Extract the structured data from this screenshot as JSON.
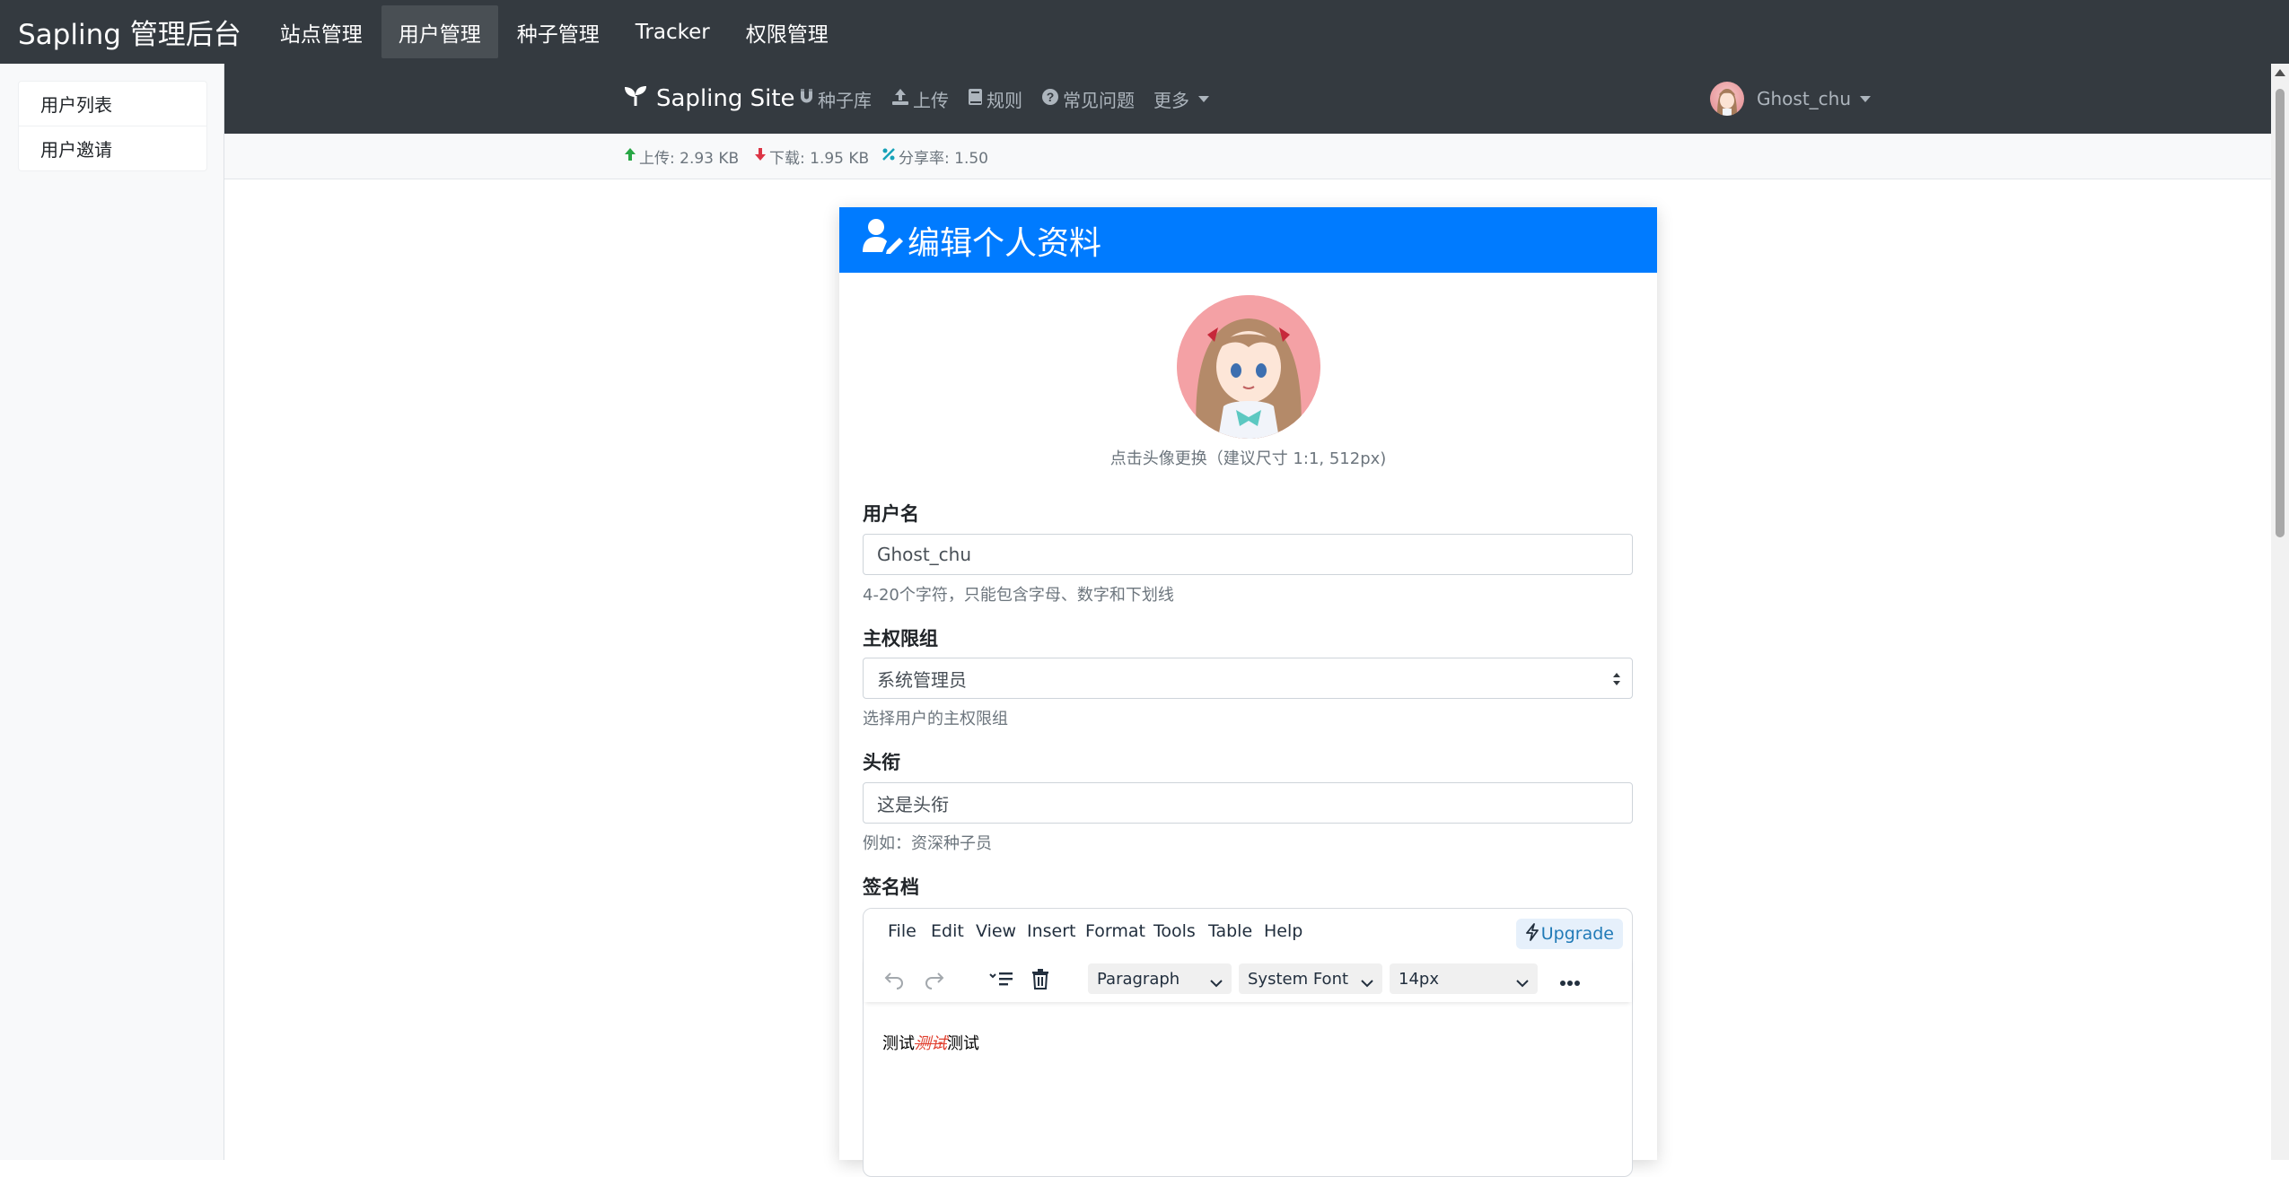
{
  "admin_nav": {
    "brand": "Sapling 管理后台",
    "items": [
      "站点管理",
      "用户管理",
      "种子管理",
      "Tracker",
      "权限管理"
    ],
    "active_index": 1
  },
  "sidebar": {
    "items": [
      "用户列表",
      "用户邀请"
    ]
  },
  "site_nav": {
    "brand": "Sapling Site",
    "links": {
      "torrents": "种子库",
      "upload": "上传",
      "rules": "规则",
      "faq": "常见问题",
      "more": "更多"
    },
    "username": "Ghost_chu"
  },
  "stats": {
    "upload": "上传: 2.93 KB",
    "download": "下载: 1.95 KB",
    "ratio": "分享率: 1.50"
  },
  "profile_card": {
    "title": "编辑个人资料",
    "avatar_hint": "点击头像更换（建议尺寸 1:1, 512px)",
    "username": {
      "label": "用户名",
      "value": "Ghost_chu",
      "help": "4-20个字符，只能包含字母、数字和下划线"
    },
    "group": {
      "label": "主权限组",
      "value": "系统管理员",
      "help": "选择用户的主权限组"
    },
    "title_field": {
      "label": "头衔",
      "value": "这是头衔",
      "help": "例如：资深种子员"
    },
    "signature": {
      "label": "签名档",
      "menu": [
        "File",
        "Edit",
        "View",
        "Insert",
        "Format",
        "Tools",
        "Table",
        "Help"
      ],
      "upgrade": "Upgrade",
      "block_format": "Paragraph",
      "font_family": "System Font",
      "font_size": "14px",
      "content": {
        "before": "测试",
        "styled": "测试",
        "after": "测试"
      }
    }
  },
  "colors": {
    "navbar_dark": "#343a40",
    "primary": "#007bff",
    "upload_arrow": "#28a745",
    "download_arrow": "#dc3545",
    "ratio_icon": "#17a2b8",
    "styled_text": "#e03e2d"
  }
}
